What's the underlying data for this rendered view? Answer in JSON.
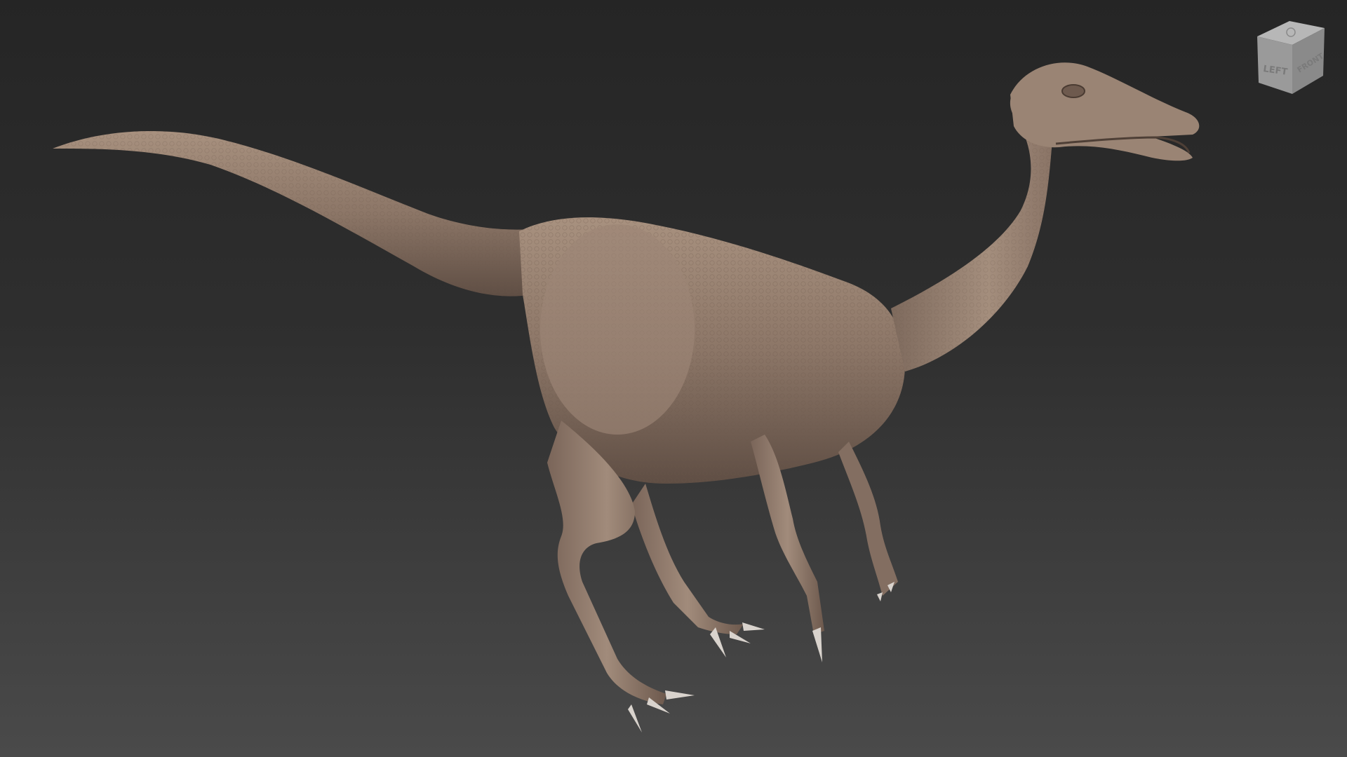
{
  "viewport": {
    "background_top": "#252525",
    "background_bottom": "#4a4a4a"
  },
  "model": {
    "skin_color": "#8f7a6c",
    "skin_shadow": "#5e4e44",
    "skin_highlight": "#b39d8c",
    "claw_color": "#d8d2cc"
  },
  "navcube": {
    "left_face_label": "LEFT",
    "front_face_label": "FRONT",
    "top_face_icon": "compass-icon",
    "face_color": "#9a9a9a"
  }
}
